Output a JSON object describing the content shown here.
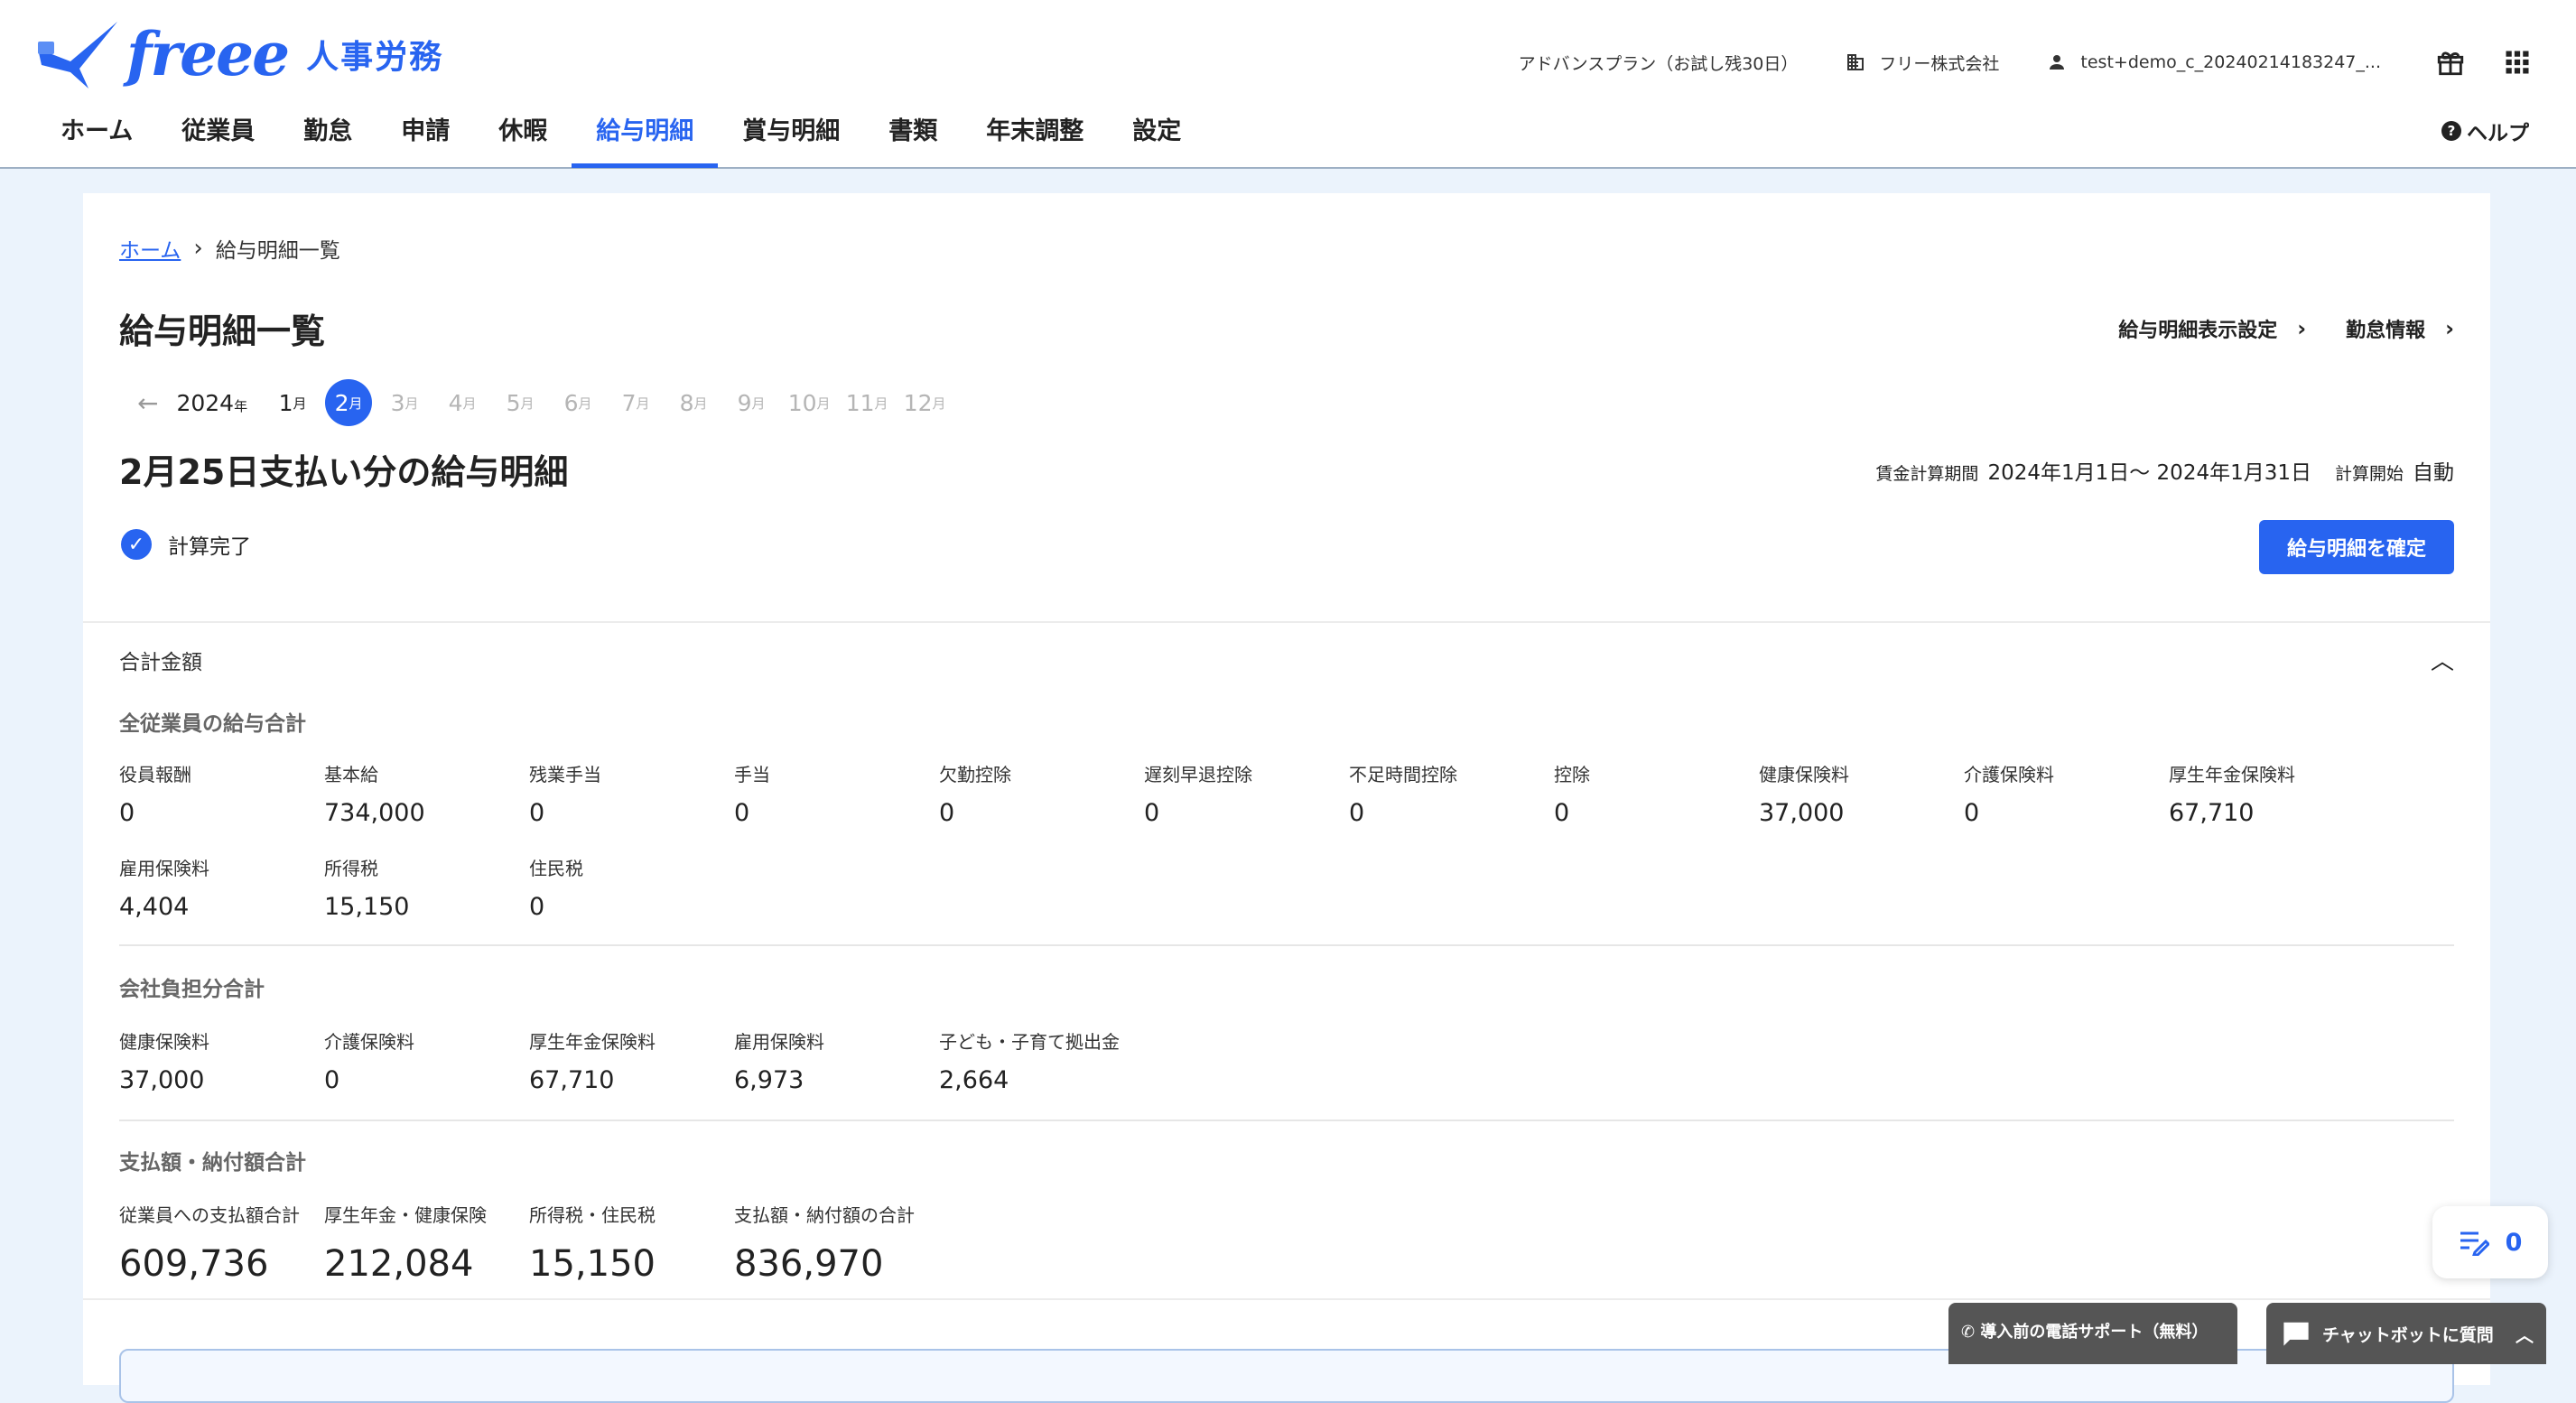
{
  "app": {
    "logo_text": "freee",
    "product_name": "人事労務",
    "plan": "アドバンスプラン（お試し残30日）",
    "company": "フリー株式会社",
    "user": "test+demo_c_20240214183247_...",
    "help_label": "ヘルプ"
  },
  "nav": {
    "tabs": [
      "ホーム",
      "従業員",
      "勤怠",
      "申請",
      "休暇",
      "給与明細",
      "賞与明細",
      "書類",
      "年末調整",
      "設定"
    ],
    "active_index": 5
  },
  "breadcrumb": {
    "home": "ホーム",
    "current": "給与明細一覧"
  },
  "page": {
    "title": "給与明細一覧",
    "link_display_settings": "給与明細表示設定",
    "link_attendance": "勤怠情報",
    "year": "2024",
    "year_suffix": "年",
    "month_suffix": "月",
    "months": [
      "1",
      "2",
      "3",
      "4",
      "5",
      "6",
      "7",
      "8",
      "9",
      "10",
      "11",
      "12"
    ],
    "selected_month_index": 1,
    "payslip_title": "2月25日支払い分の給与明細",
    "period_label": "賃金計算期間",
    "period_value": "2024年1月1日〜 2024年1月31日",
    "calc_start_label": "計算開始",
    "calc_start_value": "自動",
    "status_text": "計算完了",
    "confirm_button": "給与明細を確定"
  },
  "totals": {
    "header": "合計金額",
    "employee_section": {
      "title": "全従業員の給与合計",
      "items": [
        {
          "label": "役員報酬",
          "value": "0"
        },
        {
          "label": "基本給",
          "value": "734,000"
        },
        {
          "label": "残業手当",
          "value": "0"
        },
        {
          "label": "手当",
          "value": "0"
        },
        {
          "label": "欠勤控除",
          "value": "0"
        },
        {
          "label": "遅刻早退控除",
          "value": "0"
        },
        {
          "label": "不足時間控除",
          "value": "0"
        },
        {
          "label": "控除",
          "value": "0"
        },
        {
          "label": "健康保険料",
          "value": "37,000"
        },
        {
          "label": "介護保険料",
          "value": "0"
        },
        {
          "label": "厚生年金保険料",
          "value": "67,710"
        },
        {
          "label": "雇用保険料",
          "value": "4,404"
        },
        {
          "label": "所得税",
          "value": "15,150"
        },
        {
          "label": "住民税",
          "value": "0"
        }
      ]
    },
    "company_section": {
      "title": "会社負担分合計",
      "items": [
        {
          "label": "健康保険料",
          "value": "37,000"
        },
        {
          "label": "介護保険料",
          "value": "0"
        },
        {
          "label": "厚生年金保険料",
          "value": "67,710"
        },
        {
          "label": "雇用保険料",
          "value": "6,973"
        },
        {
          "label": "子ども・子育て拠出金",
          "value": "2,664"
        }
      ]
    },
    "payment_section": {
      "title": "支払額・納付額合計",
      "items": [
        {
          "label": "従業員への支払額合計",
          "value": "609,736"
        },
        {
          "label": "厚生年金・健康保険",
          "value": "212,084"
        },
        {
          "label": "所得税・住民税",
          "value": "15,150"
        },
        {
          "label": "支払額・納付額の合計",
          "value": "836,970"
        }
      ]
    }
  },
  "widgets": {
    "task_count": "0",
    "phone_support": "導入前の電話サポート（無料）",
    "chatbot": "チャットボットに質問"
  },
  "colors": {
    "accent": "#2864f0",
    "page_bg": "#ebf3fc"
  }
}
